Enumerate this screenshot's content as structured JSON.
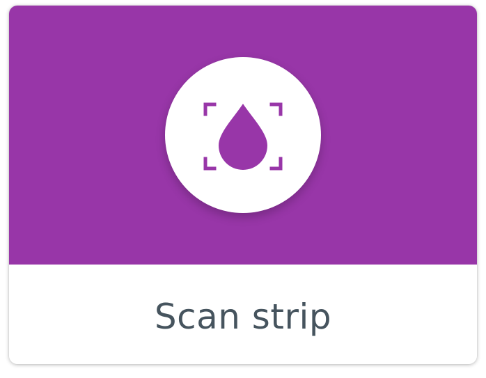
{
  "card": {
    "label": "Scan strip",
    "icon": "drop-in-scan-frame-icon"
  },
  "colors": {
    "header_background": "#9836a8",
    "icon_foreground": "#9836a8",
    "icon_background": "#ffffff",
    "label_text": "#46545e"
  }
}
